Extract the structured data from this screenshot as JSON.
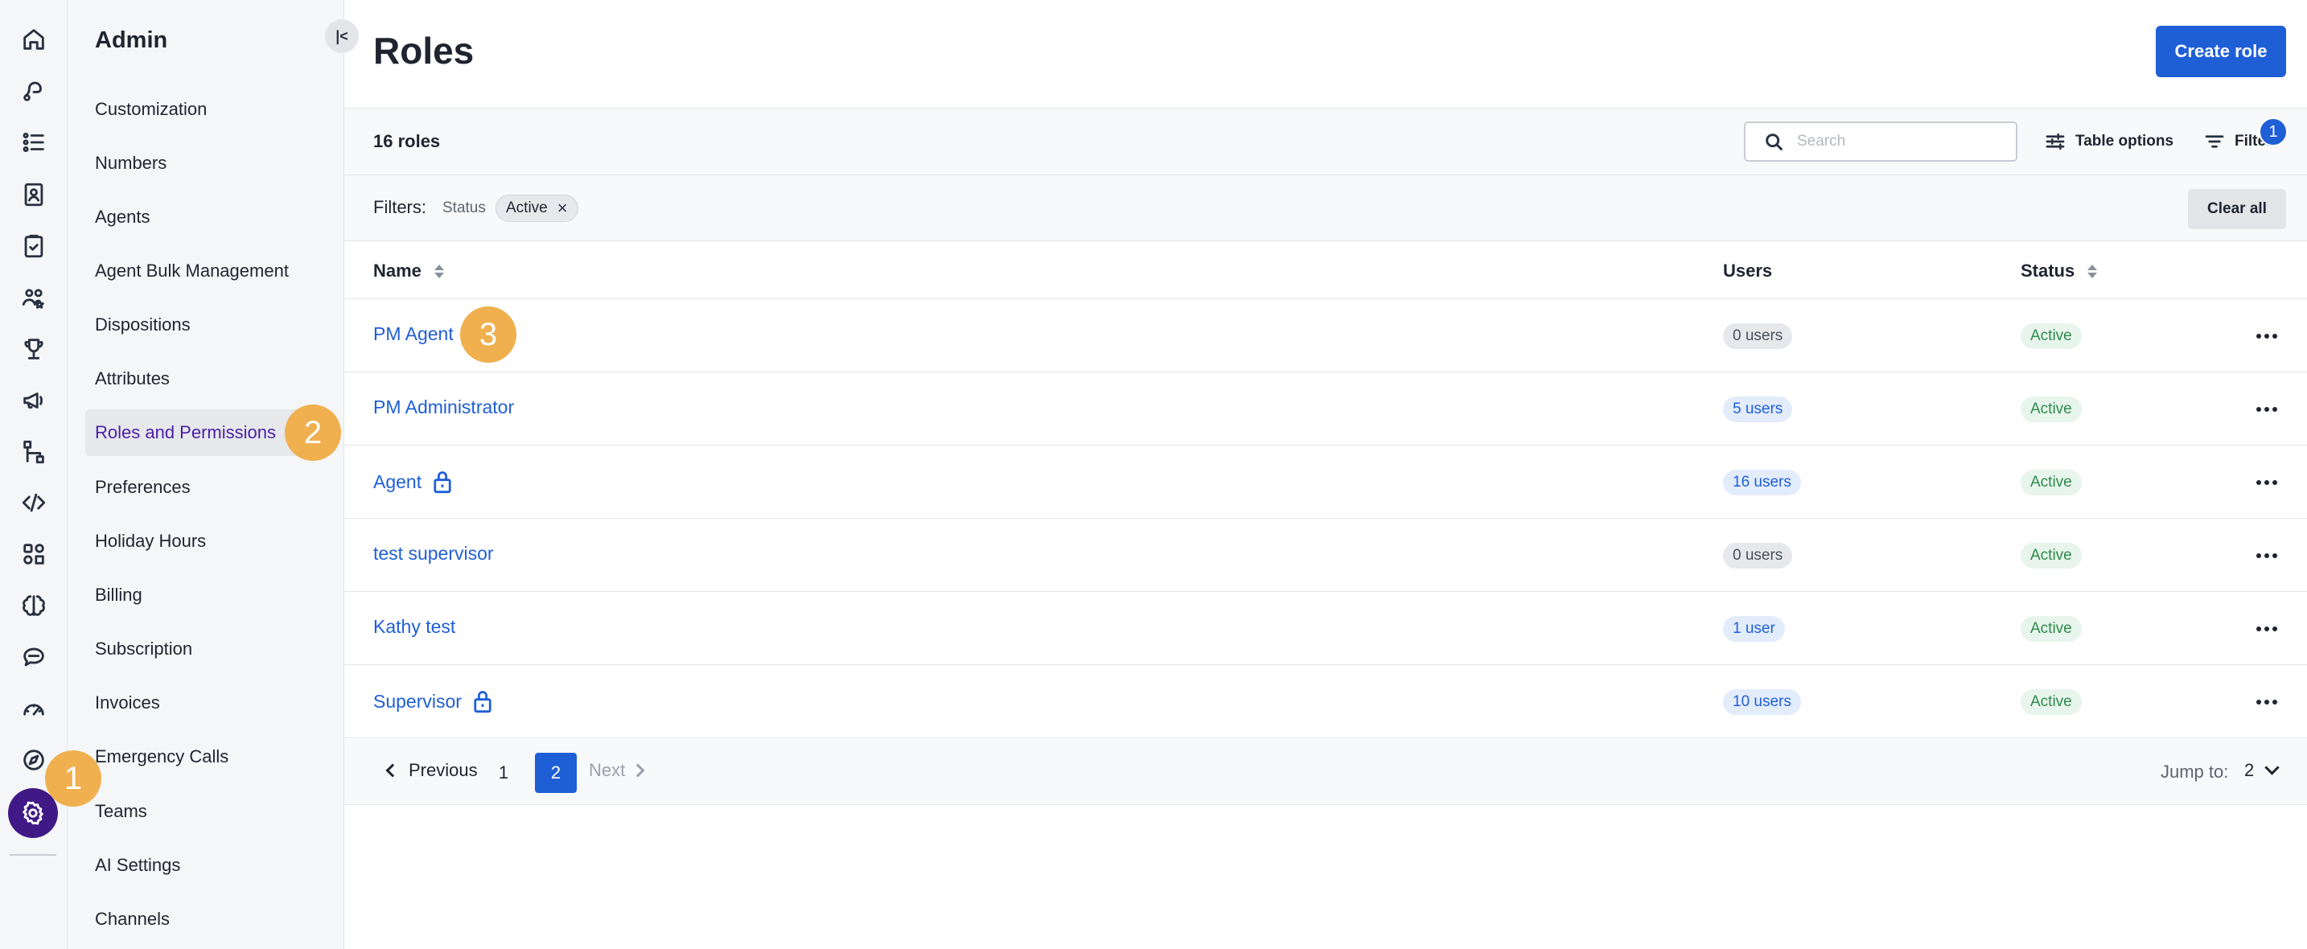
{
  "rail": {
    "icons": [
      "home-icon",
      "conversations-icon",
      "list-icon",
      "contacts-icon",
      "tasks-icon",
      "team-icon",
      "trophy-icon",
      "campaigns-icon",
      "flows-icon",
      "code-icon",
      "integrations-icon",
      "ai-brain-icon",
      "chat-icon",
      "dashboard-icon",
      "explore-icon",
      "settings-icon"
    ]
  },
  "sidebar": {
    "title": "Admin",
    "collapse_label": "|<",
    "items": [
      {
        "label": "Customization"
      },
      {
        "label": "Numbers"
      },
      {
        "label": "Agents"
      },
      {
        "label": "Agent Bulk Management"
      },
      {
        "label": "Dispositions"
      },
      {
        "label": "Attributes"
      },
      {
        "label": "Roles and Permissions",
        "active": true
      },
      {
        "label": "Preferences"
      },
      {
        "label": "Holiday Hours"
      },
      {
        "label": "Billing"
      },
      {
        "label": "Subscription"
      },
      {
        "label": "Invoices"
      },
      {
        "label": "Emergency Calls"
      },
      {
        "label": "Teams"
      },
      {
        "label": "AI Settings"
      },
      {
        "label": "Channels"
      }
    ]
  },
  "steps": [
    "1",
    "2",
    "3"
  ],
  "header": {
    "title": "Roles",
    "create_label": "Create role"
  },
  "toolbar": {
    "count": "16 roles",
    "search_placeholder": "Search",
    "table_options_label": "Table options",
    "filters_label": "Filters",
    "filters_count": "1"
  },
  "filters": {
    "label": "Filters:",
    "field": "Status",
    "value": "Active",
    "clear_label": "Clear all"
  },
  "table": {
    "columns": [
      "Name",
      "Users",
      "Status"
    ],
    "rows": [
      {
        "name": "PM Agent",
        "users": "0 users",
        "users_style": "grey",
        "status": "Active",
        "locked": false
      },
      {
        "name": "PM Administrator",
        "users": "5 users",
        "users_style": "blue",
        "status": "Active",
        "locked": false
      },
      {
        "name": "Agent",
        "users": "16 users",
        "users_style": "blue",
        "status": "Active",
        "locked": true
      },
      {
        "name": "test supervisor",
        "users": "0 users",
        "users_style": "grey",
        "status": "Active",
        "locked": false
      },
      {
        "name": "Kathy test",
        "users": "1 user",
        "users_style": "blue",
        "status": "Active",
        "locked": false
      },
      {
        "name": "Supervisor",
        "users": "10 users",
        "users_style": "blue",
        "status": "Active",
        "locked": true
      }
    ]
  },
  "pagination": {
    "prev_label": "Previous",
    "pages": [
      "1",
      "2"
    ],
    "current_page": "2",
    "next_label": "Next",
    "jump_label": "Jump to:",
    "jump_value": "2"
  },
  "colors": {
    "accent": "#1f5fd6",
    "active_nav": "#3f1a86",
    "step_badge": "#f0b04f",
    "status_active": "#2f8a4c"
  }
}
